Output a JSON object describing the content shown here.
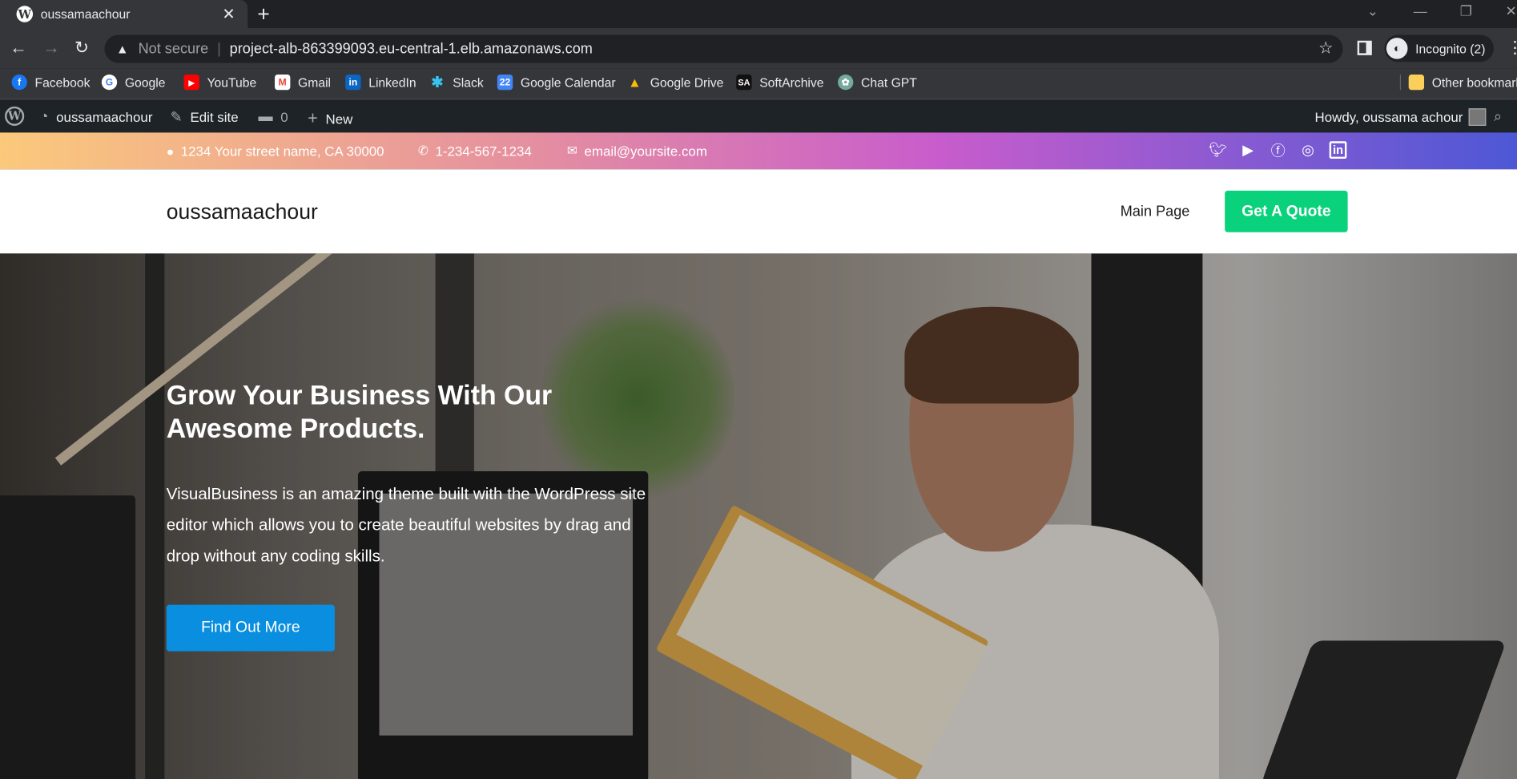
{
  "browser": {
    "tab_title": "oussamaachour",
    "tab_icon": "wordpress-icon",
    "omnibox": {
      "security_label": "Not secure",
      "url": "project-alb-863399093.eu-central-1.elb.amazonaws.com"
    },
    "profile_label": "Incognito (2)",
    "bookmarks": [
      {
        "label": "Facebook",
        "icon": "facebook-icon",
        "color": "#1877f2"
      },
      {
        "label": "Google",
        "icon": "google-icon",
        "color": "#ffffff"
      },
      {
        "label": "YouTube",
        "icon": "youtube-icon",
        "color": "#ff0000"
      },
      {
        "label": "Gmail",
        "icon": "gmail-icon",
        "color": "#ea4335"
      },
      {
        "label": "LinkedIn",
        "icon": "linkedin-icon",
        "color": "#0a66c2"
      },
      {
        "label": "Slack",
        "icon": "slack-icon",
        "color": "#e01e5a"
      },
      {
        "label": "Google Calendar",
        "icon": "google-calendar-icon",
        "color": "#4285f4"
      },
      {
        "label": "Google Drive",
        "icon": "google-drive-icon",
        "color": "#fbbc04"
      },
      {
        "label": "SoftArchive",
        "icon": "softarchive-icon",
        "color": "#111111"
      },
      {
        "label": "Chat GPT",
        "icon": "chatgpt-icon",
        "color": "#74aa9c"
      }
    ],
    "other_bookmarks": "Other bookmark"
  },
  "adminbar": {
    "site_name": "oussamaachour",
    "edit_site": "Edit site",
    "comments_count": "0",
    "new_label": "New",
    "greeting": "Howdy, oussama achour"
  },
  "contact": {
    "address": "1234 Your street name, CA 30000",
    "phone": "1-234-567-1234",
    "email": "email@yoursite.com",
    "socials": [
      "twitter-icon",
      "youtube-icon",
      "facebook-icon",
      "instagram-icon",
      "linkedin-icon"
    ]
  },
  "header": {
    "site_title": "oussamaachour",
    "nav_main": "Main Page",
    "cta_label": "Get A Quote",
    "cta_color": "#0ad17b"
  },
  "hero": {
    "title": "Grow Your Business With Our Awesome Products.",
    "body": "VisualBusiness is an amazing theme built with the WordPress site editor which allows you to create beautiful websites by drag and drop without any coding skills.",
    "button_label": "Find Out More",
    "button_color": "#0a8ee0"
  }
}
